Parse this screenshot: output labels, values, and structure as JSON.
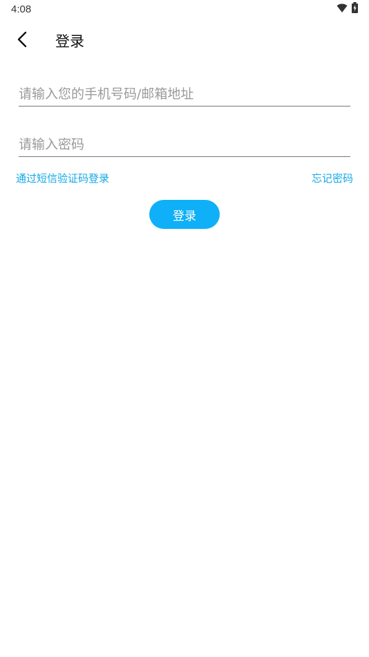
{
  "status_bar": {
    "time": "4:08"
  },
  "header": {
    "title": "登录"
  },
  "form": {
    "account_placeholder": "请输入您的手机号码/邮箱地址",
    "account_value": "",
    "password_placeholder": "请输入密码",
    "password_value": ""
  },
  "links": {
    "sms_login": "通过短信验证码登录",
    "forgot_password": "忘记密码"
  },
  "actions": {
    "login_label": "登录"
  },
  "colors": {
    "accent": "#0fb0f7",
    "link": "#13a8e8"
  },
  "icons": {
    "back": "chevron-left-icon",
    "wifi": "wifi-icon",
    "battery": "battery-charging-icon"
  }
}
